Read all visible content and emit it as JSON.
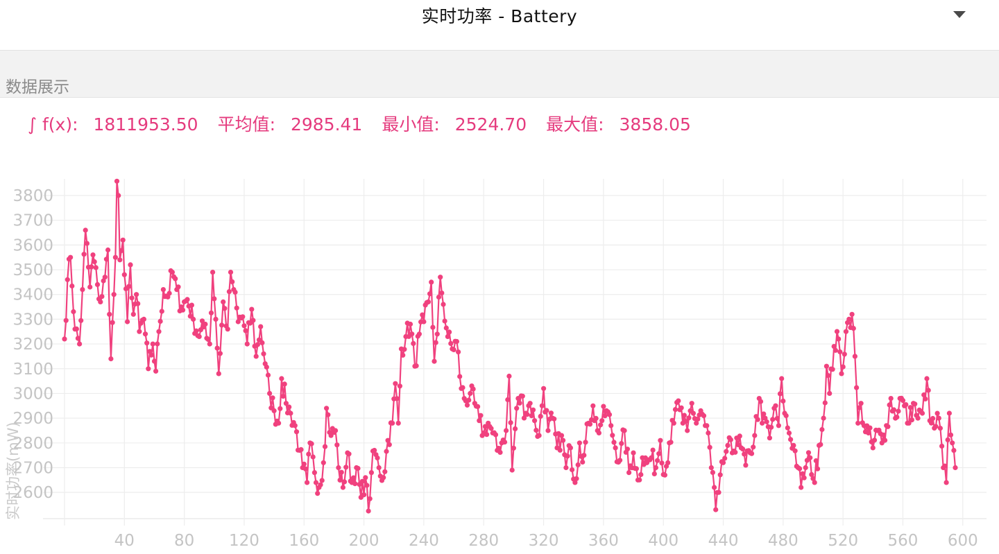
{
  "header": {
    "title": "实时功率 - Battery",
    "dropdown_icon": "triangle-down-icon"
  },
  "section": {
    "label": "数据展示"
  },
  "stats": {
    "integral_label": "∫ f(x):",
    "integral_value": "1811953.50",
    "avg_label": "平均值:",
    "avg_value": "2985.41",
    "min_label": "最小值:",
    "min_value": "2524.70",
    "max_label": "最大值:",
    "max_value": "3858.05"
  },
  "colors": {
    "series": "#f0417e",
    "stats": "#e53b7e",
    "grid": "#ececec",
    "tick": "#c4c4c4"
  },
  "chart_data": {
    "type": "line",
    "title": "",
    "xlabel": "",
    "ylabel": "实时功率(mW)",
    "xlim": [
      0,
      610
    ],
    "ylim": [
      2510,
      3880
    ],
    "xticks": [
      40,
      80,
      120,
      160,
      200,
      240,
      280,
      320,
      360,
      400,
      440,
      480,
      520,
      560,
      600
    ],
    "yticks": [
      2600,
      2700,
      2800,
      2900,
      3000,
      3100,
      3200,
      3300,
      3400,
      3500,
      3600,
      3700,
      3800
    ],
    "grid": true,
    "legend": "none",
    "markers": true,
    "series": [
      {
        "name": "Battery",
        "anchors": [
          [
            0,
            3220
          ],
          [
            2,
            3460
          ],
          [
            4,
            3550
          ],
          [
            7,
            3260
          ],
          [
            10,
            3200
          ],
          [
            12,
            3420
          ],
          [
            14,
            3660
          ],
          [
            17,
            3430
          ],
          [
            19,
            3560
          ],
          [
            22,
            3440
          ],
          [
            24,
            3370
          ],
          [
            27,
            3470
          ],
          [
            29,
            3580
          ],
          [
            31,
            3140
          ],
          [
            33,
            3400
          ],
          [
            34,
            3550
          ],
          [
            35,
            3858
          ],
          [
            36,
            3800
          ],
          [
            37,
            3540
          ],
          [
            39,
            3620
          ],
          [
            40,
            3480
          ],
          [
            42,
            3290
          ],
          [
            44,
            3520
          ],
          [
            46,
            3320
          ],
          [
            48,
            3400
          ],
          [
            50,
            3250
          ],
          [
            53,
            3300
          ],
          [
            56,
            3100
          ],
          [
            59,
            3200
          ],
          [
            61,
            3090
          ],
          [
            63,
            3250
          ],
          [
            66,
            3420
          ],
          [
            69,
            3390
          ],
          [
            72,
            3490
          ],
          [
            75,
            3420
          ],
          [
            78,
            3350
          ],
          [
            82,
            3380
          ],
          [
            86,
            3300
          ],
          [
            90,
            3230
          ],
          [
            94,
            3280
          ],
          [
            97,
            3200
          ],
          [
            99,
            3490
          ],
          [
            101,
            3300
          ],
          [
            103,
            3080
          ],
          [
            106,
            3370
          ],
          [
            109,
            3260
          ],
          [
            111,
            3490
          ],
          [
            113,
            3420
          ],
          [
            116,
            3290
          ],
          [
            119,
            3310
          ],
          [
            122,
            3200
          ],
          [
            125,
            3340
          ],
          [
            128,
            3150
          ],
          [
            131,
            3270
          ],
          [
            134,
            3120
          ],
          [
            137,
            3000
          ],
          [
            140,
            2930
          ],
          [
            143,
            2880
          ],
          [
            145,
            3060
          ],
          [
            148,
            2960
          ],
          [
            151,
            2920
          ],
          [
            154,
            2870
          ],
          [
            157,
            2770
          ],
          [
            159,
            2700
          ],
          [
            162,
            2640
          ],
          [
            164,
            2800
          ],
          [
            167,
            2680
          ],
          [
            170,
            2620
          ],
          [
            173,
            2720
          ],
          [
            175,
            2940
          ],
          [
            178,
            2830
          ],
          [
            181,
            2850
          ],
          [
            183,
            2700
          ],
          [
            186,
            2620
          ],
          [
            189,
            2760
          ],
          [
            192,
            2640
          ],
          [
            195,
            2700
          ],
          [
            198,
            2580
          ],
          [
            201,
            2660
          ],
          [
            203,
            2524.7
          ],
          [
            205,
            2680
          ],
          [
            207,
            2770
          ],
          [
            210,
            2700
          ],
          [
            213,
            2660
          ],
          [
            216,
            2810
          ],
          [
            219,
            2880
          ],
          [
            221,
            3040
          ],
          [
            223,
            2880
          ],
          [
            225,
            3180
          ],
          [
            228,
            3230
          ],
          [
            231,
            3280
          ],
          [
            234,
            3110
          ],
          [
            237,
            3240
          ],
          [
            240,
            3290
          ],
          [
            243,
            3370
          ],
          [
            245,
            3450
          ],
          [
            247,
            3130
          ],
          [
            249,
            3240
          ],
          [
            251,
            3470
          ],
          [
            253,
            3360
          ],
          [
            256,
            3230
          ],
          [
            259,
            3180
          ],
          [
            262,
            3210
          ],
          [
            265,
            3020
          ],
          [
            268,
            2970
          ],
          [
            271,
            3000
          ],
          [
            274,
            2960
          ],
          [
            277,
            2890
          ],
          [
            280,
            2840
          ],
          [
            283,
            2880
          ],
          [
            286,
            2840
          ],
          [
            289,
            2770
          ],
          [
            292,
            2800
          ],
          [
            295,
            2850
          ],
          [
            297,
            3070
          ],
          [
            299,
            2690
          ],
          [
            302,
            2940
          ],
          [
            305,
            2990
          ],
          [
            308,
            2920
          ],
          [
            311,
            2960
          ],
          [
            314,
            2890
          ],
          [
            317,
            2830
          ],
          [
            320,
            3020
          ],
          [
            323,
            2850
          ],
          [
            326,
            2900
          ],
          [
            329,
            2780
          ],
          [
            332,
            2830
          ],
          [
            335,
            2700
          ],
          [
            338,
            2780
          ],
          [
            341,
            2640
          ],
          [
            344,
            2800
          ],
          [
            347,
            2750
          ],
          [
            350,
            2880
          ],
          [
            353,
            2950
          ],
          [
            356,
            2850
          ],
          [
            359,
            2890
          ],
          [
            362,
            2930
          ],
          [
            365,
            2870
          ],
          [
            368,
            2780
          ],
          [
            371,
            2730
          ],
          [
            374,
            2850
          ],
          [
            377,
            2680
          ],
          [
            380,
            2760
          ],
          [
            383,
            2650
          ],
          [
            386,
            2740
          ],
          [
            389,
            2720
          ],
          [
            392,
            2740
          ],
          [
            395,
            2700
          ],
          [
            398,
            2810
          ],
          [
            401,
            2670
          ],
          [
            404,
            2800
          ],
          [
            407,
            2880
          ],
          [
            410,
            2970
          ],
          [
            413,
            2880
          ],
          [
            416,
            2850
          ],
          [
            419,
            2960
          ],
          [
            422,
            2880
          ],
          [
            425,
            2930
          ],
          [
            428,
            2870
          ],
          [
            430,
            2840
          ],
          [
            432,
            2700
          ],
          [
            434,
            2620
          ],
          [
            435,
            2530
          ],
          [
            437,
            2600
          ],
          [
            440,
            2720
          ],
          [
            443,
            2790
          ],
          [
            446,
            2760
          ],
          [
            449,
            2820
          ],
          [
            452,
            2780
          ],
          [
            455,
            2710
          ],
          [
            458,
            2760
          ],
          [
            461,
            2830
          ],
          [
            464,
            2980
          ],
          [
            466,
            2880
          ],
          [
            468,
            2900
          ],
          [
            471,
            2820
          ],
          [
            474,
            2940
          ],
          [
            477,
            2870
          ],
          [
            479,
            3060
          ],
          [
            481,
            2920
          ],
          [
            484,
            2840
          ],
          [
            487,
            2790
          ],
          [
            490,
            2700
          ],
          [
            492,
            2620
          ],
          [
            495,
            2700
          ],
          [
            498,
            2740
          ],
          [
            501,
            2640
          ],
          [
            504,
            2790
          ],
          [
            507,
            2900
          ],
          [
            509,
            3110
          ],
          [
            511,
            3000
          ],
          [
            514,
            3190
          ],
          [
            517,
            3220
          ],
          [
            519,
            3080
          ],
          [
            522,
            3250
          ],
          [
            524,
            3300
          ],
          [
            526,
            3320
          ],
          [
            528,
            3150
          ],
          [
            530,
            2880
          ],
          [
            532,
            2960
          ],
          [
            534,
            2870
          ],
          [
            537,
            2840
          ],
          [
            540,
            2780
          ],
          [
            543,
            2850
          ],
          [
            546,
            2800
          ],
          [
            549,
            2870
          ],
          [
            552,
            2980
          ],
          [
            555,
            2900
          ],
          [
            558,
            2980
          ],
          [
            561,
            2950
          ],
          [
            564,
            2880
          ],
          [
            567,
            2960
          ],
          [
            570,
            2900
          ],
          [
            573,
            2920
          ],
          [
            576,
            3060
          ],
          [
            578,
            2890
          ],
          [
            581,
            2860
          ],
          [
            584,
            2900
          ],
          [
            587,
            2700
          ],
          [
            589,
            2640
          ],
          [
            591,
            2920
          ],
          [
            593,
            2800
          ],
          [
            595,
            2700
          ]
        ]
      }
    ]
  }
}
